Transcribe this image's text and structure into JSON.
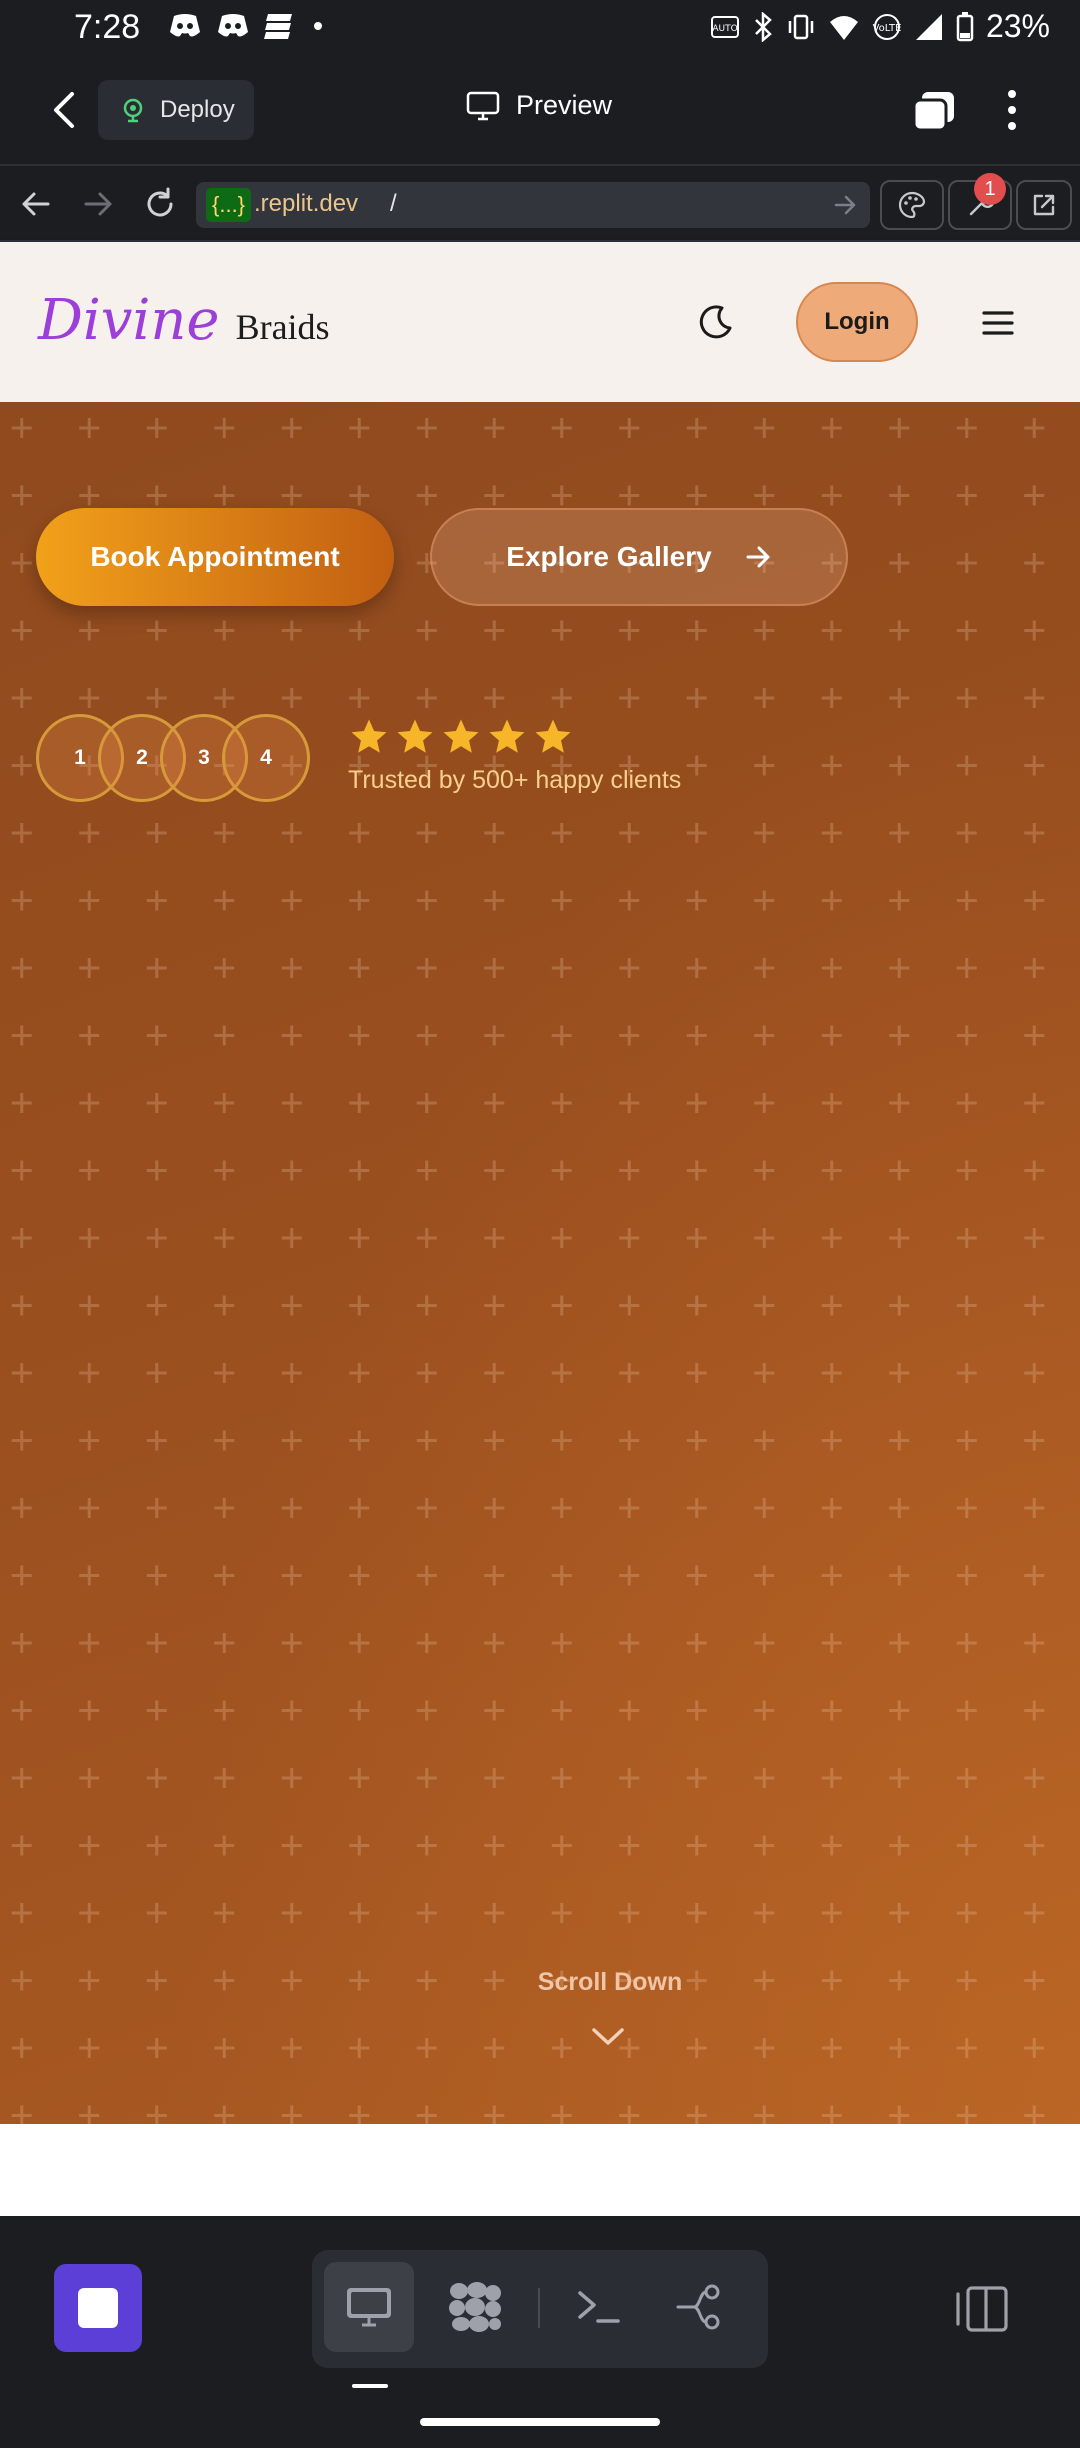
{
  "status_bar": {
    "time": "7:28",
    "battery": "23%"
  },
  "header": {
    "deploy_label": "Deploy",
    "preview_label": "Preview"
  },
  "url_bar": {
    "tag": "{...}",
    "domain": ".replit.dev",
    "path": "/",
    "notification_count": "1"
  },
  "site": {
    "logo_script": "Divine",
    "logo_text": "Braids",
    "login_label": "Login",
    "hero": {
      "book_label": "Book Appointment",
      "gallery_label": "Explore Gallery",
      "avatars": [
        "1",
        "2",
        "3",
        "4"
      ],
      "rating_stars": 5,
      "trust_text": "Trusted by 500+ happy clients",
      "scroll_label": "Scroll Down"
    }
  },
  "colors": {
    "accent": "#5b3fd6",
    "brand_purple": "#9b3fd8",
    "hero_brown": "#9a4d1c",
    "star": "#f7b52a",
    "login_bg": "#eeaa78"
  },
  "icons": [
    "back-icon",
    "deploy-icon",
    "monitor-icon",
    "tabs-icon",
    "more-icon",
    "arrow-left-icon",
    "arrow-right-icon",
    "reload-icon",
    "go-icon",
    "palette-icon",
    "wrench-icon",
    "external-link-icon",
    "moon-icon",
    "menu-icon",
    "arrow-right-icon",
    "star-icon",
    "chevron-down-icon",
    "stop-icon",
    "monitor-icon",
    "agent-icon",
    "terminal-icon",
    "git-icon",
    "panel-icon"
  ]
}
